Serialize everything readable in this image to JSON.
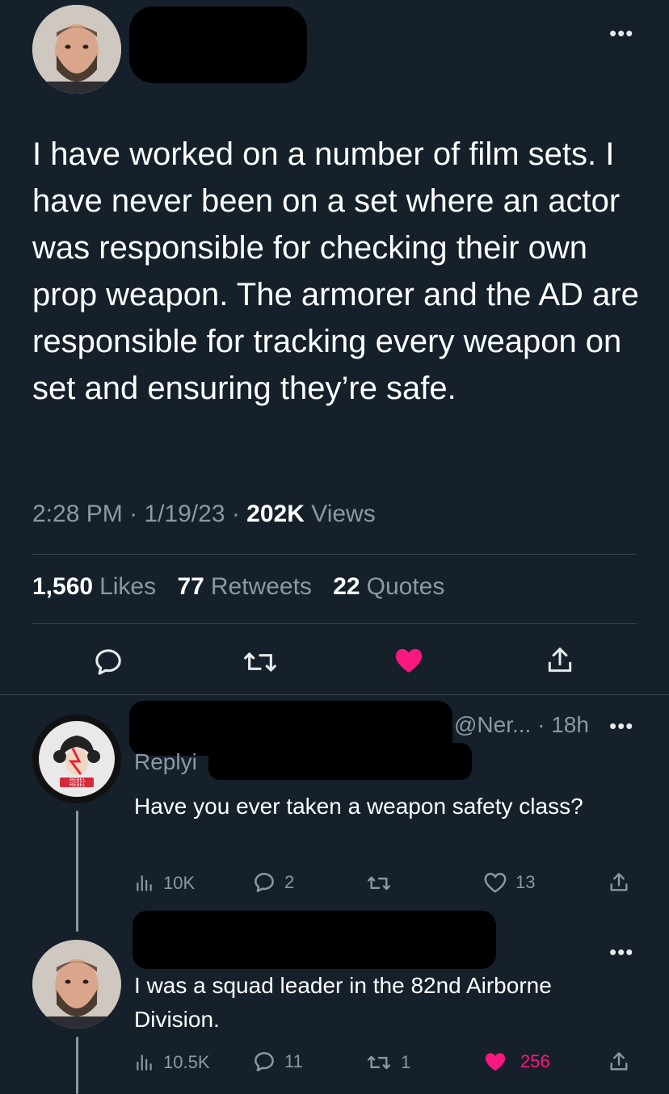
{
  "main_tweet": {
    "text": "I have worked on a number of film sets. I have never been on a set where an actor was responsible for checking their own prop weapon. The armorer and the AD are responsible for tracking every weapon on set and ensuring they’re safe.",
    "time": "2:28 PM",
    "date": "1/19/23",
    "views_count": "202K",
    "views_label": "Views",
    "likes_count": "1,560",
    "likes_label": "Likes",
    "retweets_count": "77",
    "retweets_label": "Retweets",
    "quotes_count": "22",
    "quotes_label": "Quotes",
    "more_label": "•••",
    "liked": true
  },
  "reply1": {
    "handle": "@Ner...",
    "time": "18h",
    "replying_text": "Replyi",
    "text": "Have you ever taken a weapon safety class?",
    "views": "10K",
    "replies": "2",
    "likes": "13",
    "more_label": "•••",
    "avatar_text": "REBEL REBEL"
  },
  "reply2": {
    "text": "I was a squad leader in the 82nd Airborne Division.",
    "views": "10.5K",
    "replies": "11",
    "retweets": "1",
    "likes": "256",
    "more_label": "•••",
    "liked": true
  },
  "colors": {
    "background": "#15202b",
    "secondary_text": "#8b98a5",
    "like_pink": "#f91880",
    "divider": "#38444d"
  }
}
